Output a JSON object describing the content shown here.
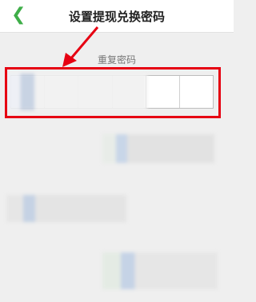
{
  "header": {
    "back_icon": "chevron-left-icon",
    "title": "设置提现兑换密码"
  },
  "form": {
    "confirm_label": "重复密码",
    "digit_count": 6
  },
  "colors": {
    "accent_green": "#3fae49",
    "highlight_red": "#e60012"
  }
}
